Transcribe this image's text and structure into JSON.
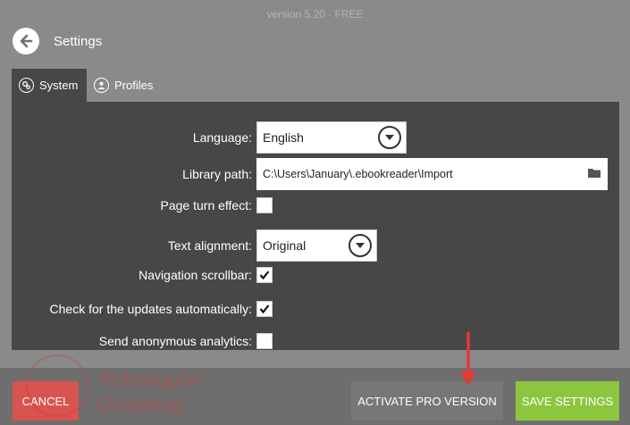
{
  "version_text": "version 5.20 - FREE",
  "header": {
    "title": "Settings",
    "back_icon": "arrow-left-icon"
  },
  "tabs": [
    {
      "label": "System",
      "icon": "gears-icon",
      "active": true
    },
    {
      "label": "Profiles",
      "icon": "user-icon",
      "active": false
    }
  ],
  "settings": {
    "language": {
      "label": "Language:",
      "value": "English"
    },
    "library_path": {
      "label": "Library path:",
      "value": "C:\\Users\\January\\.ebookreader\\Import",
      "icon": "folder-icon"
    },
    "page_turn": {
      "label": "Page turn effect:",
      "checked": false
    },
    "text_alignment": {
      "label": "Text alignment:",
      "value": "Original"
    },
    "nav_scrollbar": {
      "label": "Navigation scrollbar:",
      "checked": true
    },
    "check_updates": {
      "label": "Check for the updates automatically:",
      "checked": true
    },
    "analytics": {
      "label": "Send anonymous analytics:",
      "checked": false
    }
  },
  "footer": {
    "cancel_label": "CANCEL",
    "pro_label": "ACTIVATE PRO VERSION",
    "save_label": "SAVE SETTINGS"
  },
  "watermark": {
    "line1": "Tickcoupon",
    "line2": "Giveaway"
  },
  "colors": {
    "background": "#8a8a8a",
    "panel": "#474747",
    "cancel": "#d9534f",
    "save": "#8cc63f",
    "annotation_arrow": "#e53935"
  }
}
